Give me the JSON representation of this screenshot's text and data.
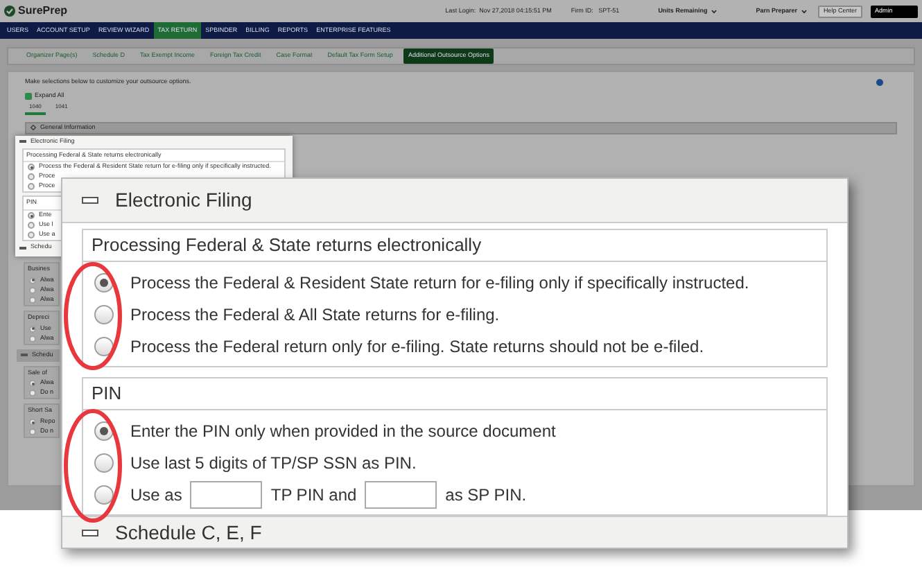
{
  "header": {
    "logo": "SurePrep",
    "last_login": "Last Login:  Nov 27,2018 04:15:51 PM",
    "firm_id": "Firm ID:   SPT-51",
    "menus": [
      "Units Remaining",
      "Parn Preparer"
    ],
    "help": "Help Center",
    "user": "Admin"
  },
  "nav": [
    {
      "label": "USERS",
      "selected": false
    },
    {
      "label": "ACCOUNT SETUP",
      "selected": false
    },
    {
      "label": "REVIEW WIZARD",
      "selected": false
    },
    {
      "label": "TAX RETURN",
      "selected": true
    },
    {
      "label": "SPBINDER",
      "selected": false
    },
    {
      "label": "BILLING",
      "selected": false
    },
    {
      "label": "REPORTS",
      "selected": false
    },
    {
      "label": "ENTERPRISE FEATURES",
      "selected": false
    }
  ],
  "subtabs": [
    {
      "label": "Organizer Page(s)",
      "selected": false
    },
    {
      "label": "Schedule D",
      "selected": false
    },
    {
      "label": "Tax Exempt Income",
      "selected": false
    },
    {
      "label": "Foreign Tax Credit",
      "selected": false
    },
    {
      "label": "Case Format",
      "selected": false
    },
    {
      "label": "Default Tax Form Setup",
      "selected": false
    },
    {
      "label": "Additional Outsource Options",
      "selected": true
    }
  ],
  "intro": "Make selections below to customize your outsource options.",
  "expand_all": "Expand All",
  "form_tabs": [
    {
      "label": "1040",
      "selected": true
    },
    {
      "label": "1041",
      "selected": false
    }
  ],
  "general_section": "General Information",
  "preview": {
    "title": "Electronic Filing",
    "group1": "Processing Federal & State returns electronically",
    "options1": [
      {
        "label": "Process the Federal & Resident State return for e-filing only if specifically instructed.",
        "selected": true
      },
      {
        "label": "Proce",
        "selected": false
      },
      {
        "label": "Proce",
        "selected": false
      }
    ],
    "group2": "PIN",
    "options2": [
      {
        "label": "Ente",
        "selected": true
      },
      {
        "label": "Use l",
        "selected": false
      },
      {
        "label": "Use a",
        "selected": false
      }
    ],
    "next": "Schedu"
  },
  "side_groups": [
    {
      "title": "Busines",
      "options": [
        {
          "label": "Alwa",
          "selected": true
        },
        {
          "label": "Alwa",
          "selected": false
        },
        {
          "label": "Alwa",
          "selected": false
        }
      ]
    },
    {
      "title": "Depreci",
      "options": [
        {
          "label": "Use",
          "selected": true
        },
        {
          "label": "Alwa",
          "selected": false
        }
      ]
    },
    {
      "title": "Schedu",
      "kind": "section"
    },
    {
      "title": "Sale of",
      "options": [
        {
          "label": "Alwa",
          "selected": true
        },
        {
          "label": "Do n",
          "selected": false
        }
      ]
    },
    {
      "title": "Short Sa",
      "options": [
        {
          "label": "Repo",
          "selected": true
        },
        {
          "label": "Do n",
          "selected": false
        }
      ]
    }
  ],
  "callout": {
    "title": "Electronic Filing",
    "group1": "Processing Federal & State returns electronically",
    "options1": [
      {
        "label": "Process the Federal & Resident State return for e-filing only if specifically instructed.",
        "selected": true
      },
      {
        "label": "Process the Federal & All State returns for e-filing.",
        "selected": false
      },
      {
        "label": "Process the Federal return only for e-filing. State returns should not be e-filed.",
        "selected": false
      }
    ],
    "group2": "PIN",
    "pin_options": [
      {
        "kind": "text",
        "label": "Enter the PIN only when provided in the source document",
        "selected": true
      },
      {
        "kind": "text",
        "label": "Use last 5 digits of TP/SP SSN as PIN.",
        "selected": false
      },
      {
        "kind": "inputs",
        "parts": [
          "Use as",
          "TP PIN and",
          "as SP PIN."
        ],
        "selected": false
      }
    ],
    "next_section": "Schedule C, E, F"
  }
}
